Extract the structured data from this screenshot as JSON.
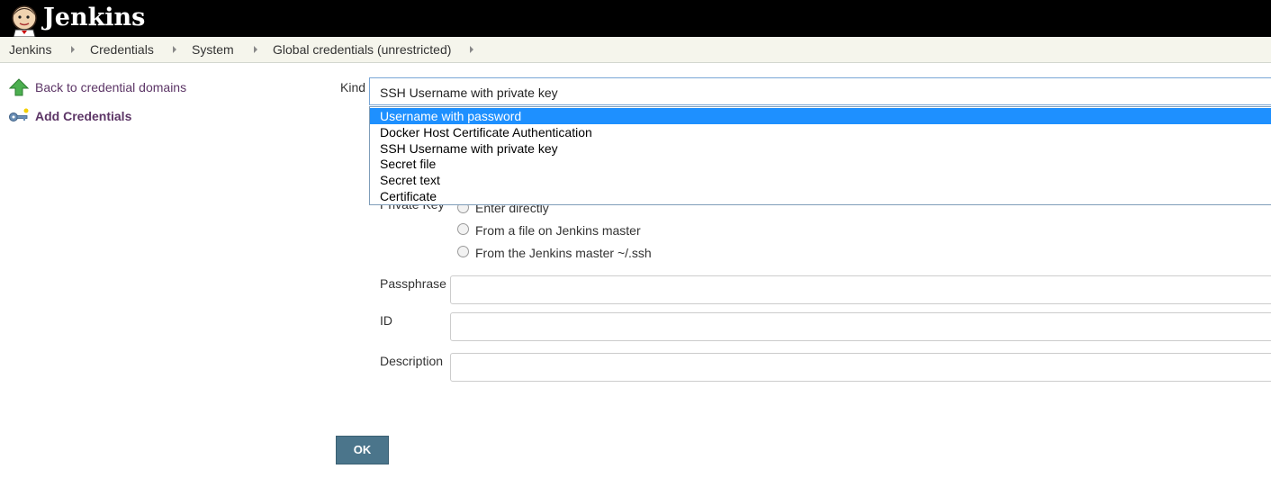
{
  "header": {
    "logo_text": "Jenkins",
    "logo_icon": "jenkins-butler-icon"
  },
  "breadcrumbs": [
    "Jenkins",
    "Credentials",
    "System",
    "Global credentials (unrestricted)"
  ],
  "sidebar": {
    "items": [
      {
        "label": "Back to credential domains",
        "icon": "up-arrow-icon"
      },
      {
        "label": "Add Credentials",
        "icon": "key-icon"
      }
    ]
  },
  "form": {
    "kind_label": "Kind",
    "kind_selected": "SSH Username with private key",
    "kind_options": [
      "Username with password",
      "Docker Host Certificate Authentication",
      "SSH Username with private key",
      "Secret file",
      "Secret text",
      "Certificate"
    ],
    "kind_highlighted": "Username with password",
    "private_key_label": "Private Key",
    "private_key_options": [
      "Enter directly",
      "From a file on Jenkins master",
      "From the Jenkins master ~/.ssh"
    ],
    "passphrase_label": "Passphrase",
    "passphrase_value": "",
    "id_label": "ID",
    "id_value": "",
    "description_label": "Description",
    "description_value": ""
  },
  "buttons": {
    "ok_label": "OK"
  },
  "colors": {
    "header_bg": "#000000",
    "highlight": "#1e90ff",
    "ok_bg": "#4b758b",
    "link": "#5c3566"
  }
}
